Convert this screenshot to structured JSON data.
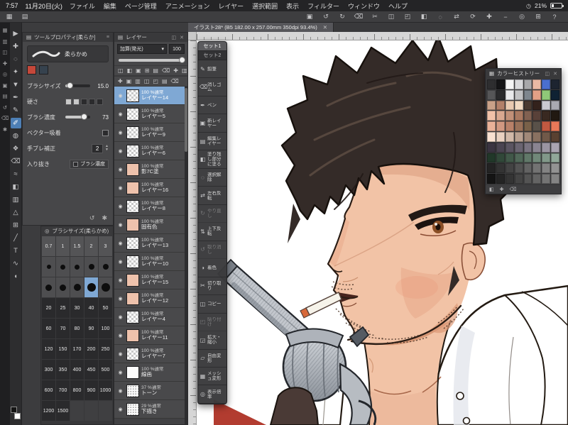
{
  "status_bar": {
    "time": "7:57",
    "date": "11月20日(火)",
    "battery": "21%"
  },
  "menu_bar": {
    "items": [
      "ファイル",
      "編集",
      "ページ管理",
      "アニメーション",
      "レイヤー",
      "選択範囲",
      "表示",
      "フィルター",
      "ウィンドウ",
      "ヘルプ"
    ]
  },
  "command_bar": {
    "left_icons": [
      {
        "name": "workspace-icon",
        "glyph": "▦"
      },
      {
        "name": "palette-dock-icon",
        "glyph": "▤"
      }
    ],
    "icons": [
      {
        "name": "save-icon",
        "glyph": "▣"
      },
      {
        "name": "undo-icon",
        "glyph": "↺"
      },
      {
        "name": "redo-icon",
        "glyph": "↻"
      },
      {
        "name": "clear-icon",
        "glyph": "⌫"
      },
      {
        "name": "cut-icon",
        "glyph": "✂"
      },
      {
        "name": "copy-icon",
        "glyph": "◫"
      },
      {
        "name": "paste-icon",
        "glyph": "◰"
      },
      {
        "name": "fill-icon",
        "glyph": "◧"
      },
      {
        "name": "deselect-icon",
        "glyph": "◌"
      },
      {
        "name": "flip-horizontal-icon",
        "glyph": "⇄"
      },
      {
        "name": "rotate-icon",
        "glyph": "⟳"
      },
      {
        "name": "zoom-in-icon",
        "glyph": "✚"
      },
      {
        "name": "zoom-out-icon",
        "glyph": "−"
      },
      {
        "name": "fit-screen-icon",
        "glyph": "◎"
      },
      {
        "name": "grid-icon",
        "glyph": "⊞"
      },
      {
        "name": "help-icon",
        "glyph": "?"
      }
    ]
  },
  "document_tab": {
    "title": "イラスト28* (B5 182.00 x 257.00mm 350dpi 93.4%)"
  },
  "edge_toolbar": {
    "icons": [
      "▦",
      "▥",
      "◫",
      "✚",
      "◎",
      "▣",
      "▤",
      "↺",
      "⌫",
      "✱"
    ]
  },
  "toolbar": {
    "tools": [
      {
        "name": "operation-tool",
        "glyph": "▶"
      },
      {
        "name": "move-tool",
        "glyph": "✚"
      },
      {
        "name": "lasso-tool",
        "glyph": "◌"
      },
      {
        "name": "wand-tool",
        "glyph": "✦"
      },
      {
        "name": "eyedropper-tool",
        "glyph": "▼"
      },
      {
        "name": "pen-tool",
        "glyph": "✒"
      },
      {
        "name": "pencil-tool",
        "glyph": "✎"
      },
      {
        "name": "brush-tool",
        "glyph": "✐",
        "selected": true
      },
      {
        "name": "airbrush-tool",
        "glyph": "◍"
      },
      {
        "name": "decoration-tool",
        "glyph": "❖"
      },
      {
        "name": "eraser-tool",
        "glyph": "⌫"
      },
      {
        "name": "blend-tool",
        "glyph": "≈"
      },
      {
        "name": "fill-tool",
        "glyph": "◧"
      },
      {
        "name": "gradient-tool",
        "glyph": "▥"
      },
      {
        "name": "figure-tool",
        "glyph": "△"
      },
      {
        "name": "frame-tool",
        "glyph": "⊞"
      },
      {
        "name": "ruler-tool",
        "glyph": "╱"
      },
      {
        "name": "text-tool",
        "glyph": "T"
      },
      {
        "name": "line-correct-tool",
        "glyph": "∿"
      },
      {
        "name": "balloon-tool",
        "glyph": "◖"
      }
    ]
  },
  "tool_property": {
    "title": "ツールプロパティ[柔らか]",
    "subtool": "柔らかめ",
    "color_chips": [
      "#c5483a",
      "#36424e"
    ],
    "params": {
      "brush_size": {
        "label": "ブラシサイズ",
        "value": "15.0"
      },
      "hardness": {
        "label": "硬さ"
      },
      "density": {
        "label": "ブラシ濃度",
        "value": "73"
      },
      "vector": {
        "label": "ベクター吸着"
      },
      "stabilize": {
        "label": "手ブレ補正",
        "value": "2"
      },
      "inout": {
        "label": "入り抜き",
        "value": "ブラシ濃度"
      }
    }
  },
  "brush_size_panel": {
    "title": "ブラシサイズ(柔らかめ)",
    "selected": "15",
    "rows": [
      {
        "type": "num",
        "values": [
          "0.7",
          "1",
          "1.5",
          "2",
          "3"
        ]
      },
      {
        "type": "dot",
        "values": [
          "4",
          "5",
          "6",
          "7",
          "8"
        ]
      },
      {
        "type": "dot",
        "values": [
          "9",
          "10",
          "12",
          "15",
          "17"
        ]
      },
      {
        "type": "dark",
        "values": [
          "20",
          "25",
          "30",
          "40",
          "50"
        ]
      },
      {
        "type": "dark",
        "values": [
          "60",
          "70",
          "80",
          "90",
          "100"
        ]
      },
      {
        "type": "dark",
        "values": [
          "120",
          "150",
          "170",
          "200",
          "250"
        ]
      },
      {
        "type": "dark",
        "values": [
          "300",
          "350",
          "400",
          "450",
          "500"
        ]
      },
      {
        "type": "dark",
        "values": [
          "600",
          "700",
          "800",
          "900",
          "1000"
        ]
      },
      {
        "type": "dark",
        "values": [
          "1200",
          "1500",
          "",
          "",
          ""
        ]
      }
    ]
  },
  "layers_panel": {
    "title": "レイヤー",
    "blend_mode": "加算(発光)",
    "opacity": "100",
    "toolbar_icons_a": [
      "◫",
      "◧",
      "▣",
      "⊞",
      "▤",
      "⌫",
      "✚",
      "▥"
    ],
    "toolbar_icons_b": [
      "✚",
      "▣",
      "▥",
      "◫",
      "◰",
      "▤",
      "⌫"
    ],
    "rows": [
      {
        "opacity": "100 %",
        "mode": "通常",
        "name": "レイヤー14",
        "thumb": "checker",
        "selected": true
      },
      {
        "opacity": "100 %",
        "mode": "通常",
        "name": "レイヤー5",
        "thumb": "checker"
      },
      {
        "opacity": "100 %",
        "mode": "通常",
        "name": "レイヤー9",
        "thumb": "checker"
      },
      {
        "opacity": "100 %",
        "mode": "通常",
        "name": "レイヤー6",
        "thumb": "checker"
      },
      {
        "opacity": "100 %",
        "mode": "通常",
        "name": "影7C塗",
        "thumb": "pink"
      },
      {
        "opacity": "100 %",
        "mode": "通常",
        "name": "レイヤー16",
        "thumb": "pink"
      },
      {
        "opacity": "100 %",
        "mode": "通常",
        "name": "レイヤー8",
        "thumb": "checker"
      },
      {
        "opacity": "100 %",
        "mode": "通常",
        "name": "固有色",
        "thumb": "pink"
      },
      {
        "opacity": "100 %",
        "mode": "通常",
        "name": "レイヤー13",
        "thumb": "checker"
      },
      {
        "opacity": "100 %",
        "mode": "通常",
        "name": "レイヤー10",
        "thumb": "checker"
      },
      {
        "opacity": "100 %",
        "mode": "通常",
        "name": "レイヤー15",
        "thumb": "pink"
      },
      {
        "opacity": "100 %",
        "mode": "通常",
        "name": "レイヤー12",
        "thumb": "pink"
      },
      {
        "opacity": "100 %",
        "mode": "通常",
        "name": "レイヤー4",
        "thumb": "checker"
      },
      {
        "opacity": "100 %",
        "mode": "通常",
        "name": "レイヤー11",
        "thumb": "pink"
      },
      {
        "opacity": "100 %",
        "mode": "通常",
        "name": "レイヤー7",
        "thumb": "checker"
      },
      {
        "opacity": "100 %",
        "mode": "通常",
        "name": "線画",
        "thumb": "white"
      },
      {
        "opacity": "37 %",
        "mode": "通常",
        "name": "トーン",
        "thumb": "tone"
      },
      {
        "opacity": "29 %",
        "mode": "通常",
        "name": "下描き",
        "thumb": "tone"
      }
    ]
  },
  "quick_access": {
    "tabs": [
      {
        "label": "セット1",
        "active": true
      },
      {
        "label": "セット2",
        "active": false
      }
    ],
    "items": [
      {
        "label": "鉛筆",
        "glyph": "✎"
      },
      {
        "label": "消しゴム",
        "glyph": "⌫"
      },
      {
        "label": "ペン",
        "glyph": "✒"
      },
      {
        "label": "新レイヤー",
        "glyph": "▣"
      },
      {
        "label": "編集レイヤー",
        "glyph": "▤"
      },
      {
        "label": "塗り残し部分に塗る",
        "glyph": "◧"
      },
      {
        "label": "選択解除",
        "glyph": "◌"
      },
      {
        "label": "左右反転",
        "glyph": "⇄"
      },
      {
        "label": "やり直し",
        "glyph": "↻",
        "disabled": true
      },
      {
        "label": "上下反転",
        "glyph": "⇅"
      },
      {
        "label": "取り消し",
        "glyph": "↺",
        "disabled": true
      },
      {
        "label": "着色",
        "glyph": "◑"
      },
      {
        "label": "切り取り",
        "glyph": "✂"
      },
      {
        "label": "コピー",
        "glyph": "◫"
      },
      {
        "label": "貼り付け",
        "glyph": "◰",
        "disabled": true
      },
      {
        "label": "拡大・縮小",
        "glyph": "◲"
      },
      {
        "label": "自由変形",
        "glyph": "▱"
      },
      {
        "label": "メッシュ変形",
        "glyph": "▦"
      },
      {
        "label": "表示倍率",
        "glyph": "◎"
      }
    ]
  },
  "color_history": {
    "title": "カラーヒストリー",
    "footer_icons": [
      "◧",
      "✚",
      "⌫"
    ],
    "colors": [
      "#2e2e30",
      "#151517",
      "#f5f5f5",
      "#d9d9db",
      "#a8a8aa",
      "#e9b9a4",
      "#4a6fd0",
      "#1d2430",
      "#565658",
      "#2a2a2c",
      "#e9e9eb",
      "#c2c2c4",
      "#7e868e",
      "#e3a086",
      "#8fc878",
      "#0f2233",
      "#c9a188",
      "#b28069",
      "#e9cab1",
      "#f1dac2",
      "#4a3a30",
      "#33221c",
      "#c9c9d1",
      "#a9a9b1",
      "#f1c1a8",
      "#d9a890",
      "#c19078",
      "#a97961",
      "#816151",
      "#594139",
      "#392921",
      "#211911",
      "#e9b198",
      "#d19881",
      "#b98169",
      "#997159",
      "#796149",
      "#595149",
      "#c15941",
      "#e97959",
      "#f9e1d1",
      "#e9d1c1",
      "#d1b9a9",
      "#b9a191",
      "#a18979",
      "#897161",
      "#715949",
      "#594131",
      "#3a3441",
      "#4a4451",
      "#5a5461",
      "#6a6471",
      "#7a7481",
      "#8a8491",
      "#9a94a1",
      "#aaa4b1",
      "#213829",
      "#314839",
      "#415849",
      "#516859",
      "#617869",
      "#718879",
      "#819889",
      "#91a899",
      "#232323",
      "#333333",
      "#434343",
      "#535353",
      "#636363",
      "#737373",
      "#838383",
      "#939393",
      "#141414",
      "#242424",
      "#343434",
      "#444444",
      "#545454",
      "#646464",
      "#747474",
      "#848484"
    ]
  },
  "canvas": {
    "colors": {
      "hair": "#342b28",
      "skin": "#f2c3a6",
      "skin_shadow": "#e7a888",
      "shirt": "#ffffff",
      "gun": "#b7bcc2",
      "line": "#2a1c14"
    }
  }
}
